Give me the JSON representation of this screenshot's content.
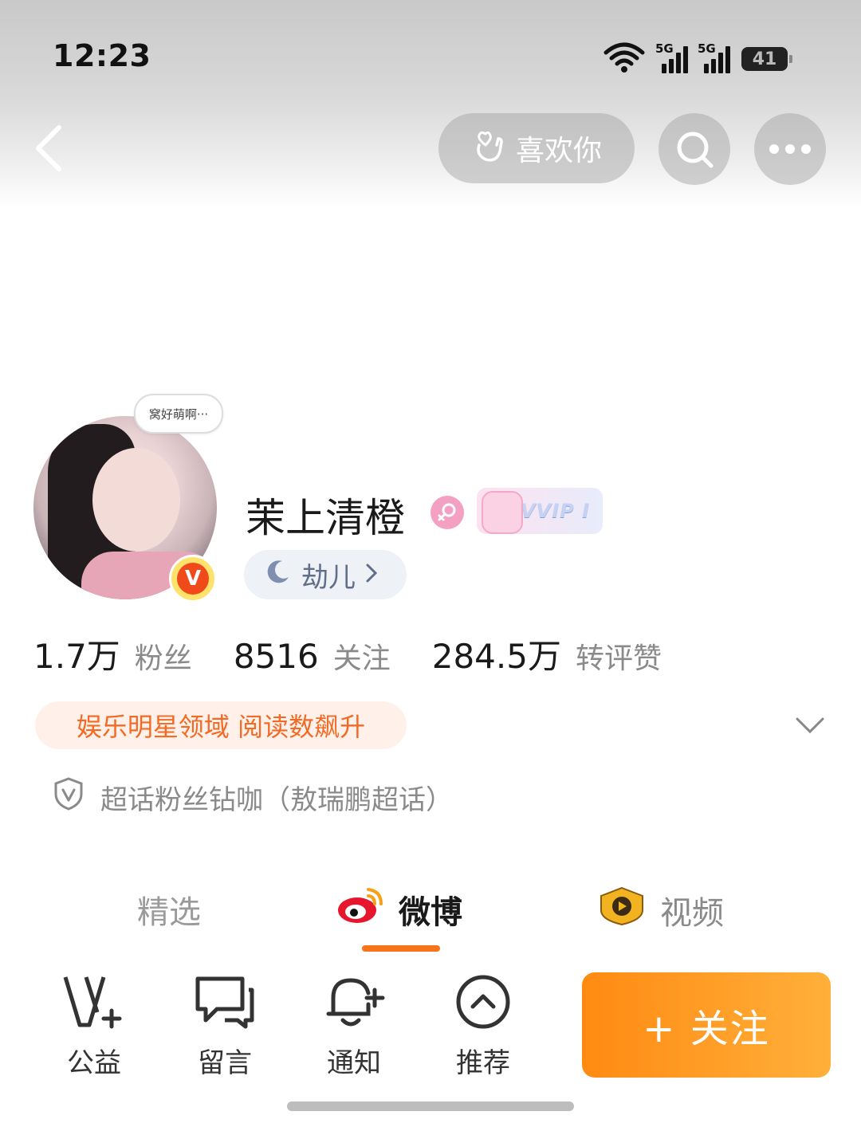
{
  "status_bar": {
    "time": "12:23",
    "network_1": "5G",
    "network_2": "5G",
    "battery": "41"
  },
  "header": {
    "like_label": "喜欢你"
  },
  "profile": {
    "avatar_bubble": "窝好萌啊···",
    "name": "茉上清橙",
    "vip_badge": "VVIP Ⅰ",
    "tag": "劫儿",
    "verified_badge": "V"
  },
  "stats": [
    {
      "value": "1.7万",
      "label": "粉丝"
    },
    {
      "value": "8516",
      "label": "关注"
    },
    {
      "value": "284.5万",
      "label": "转评赞"
    }
  ],
  "hot_tag": "娱乐明星领域 阅读数飙升",
  "fan_title": "超话粉丝钻咖（敖瑞鹏超话）",
  "tabs": [
    {
      "label": "精选"
    },
    {
      "label": "微博"
    },
    {
      "label": "视频"
    }
  ],
  "toolbar": {
    "charity": "公益",
    "message": "留言",
    "notify": "通知",
    "recommend": "推荐",
    "follow": "+ 关注"
  },
  "colors": {
    "accent": "#f7741c",
    "follow_start": "#ff8a12",
    "follow_end": "#ffb03a",
    "hot_text": "#f26a24"
  }
}
